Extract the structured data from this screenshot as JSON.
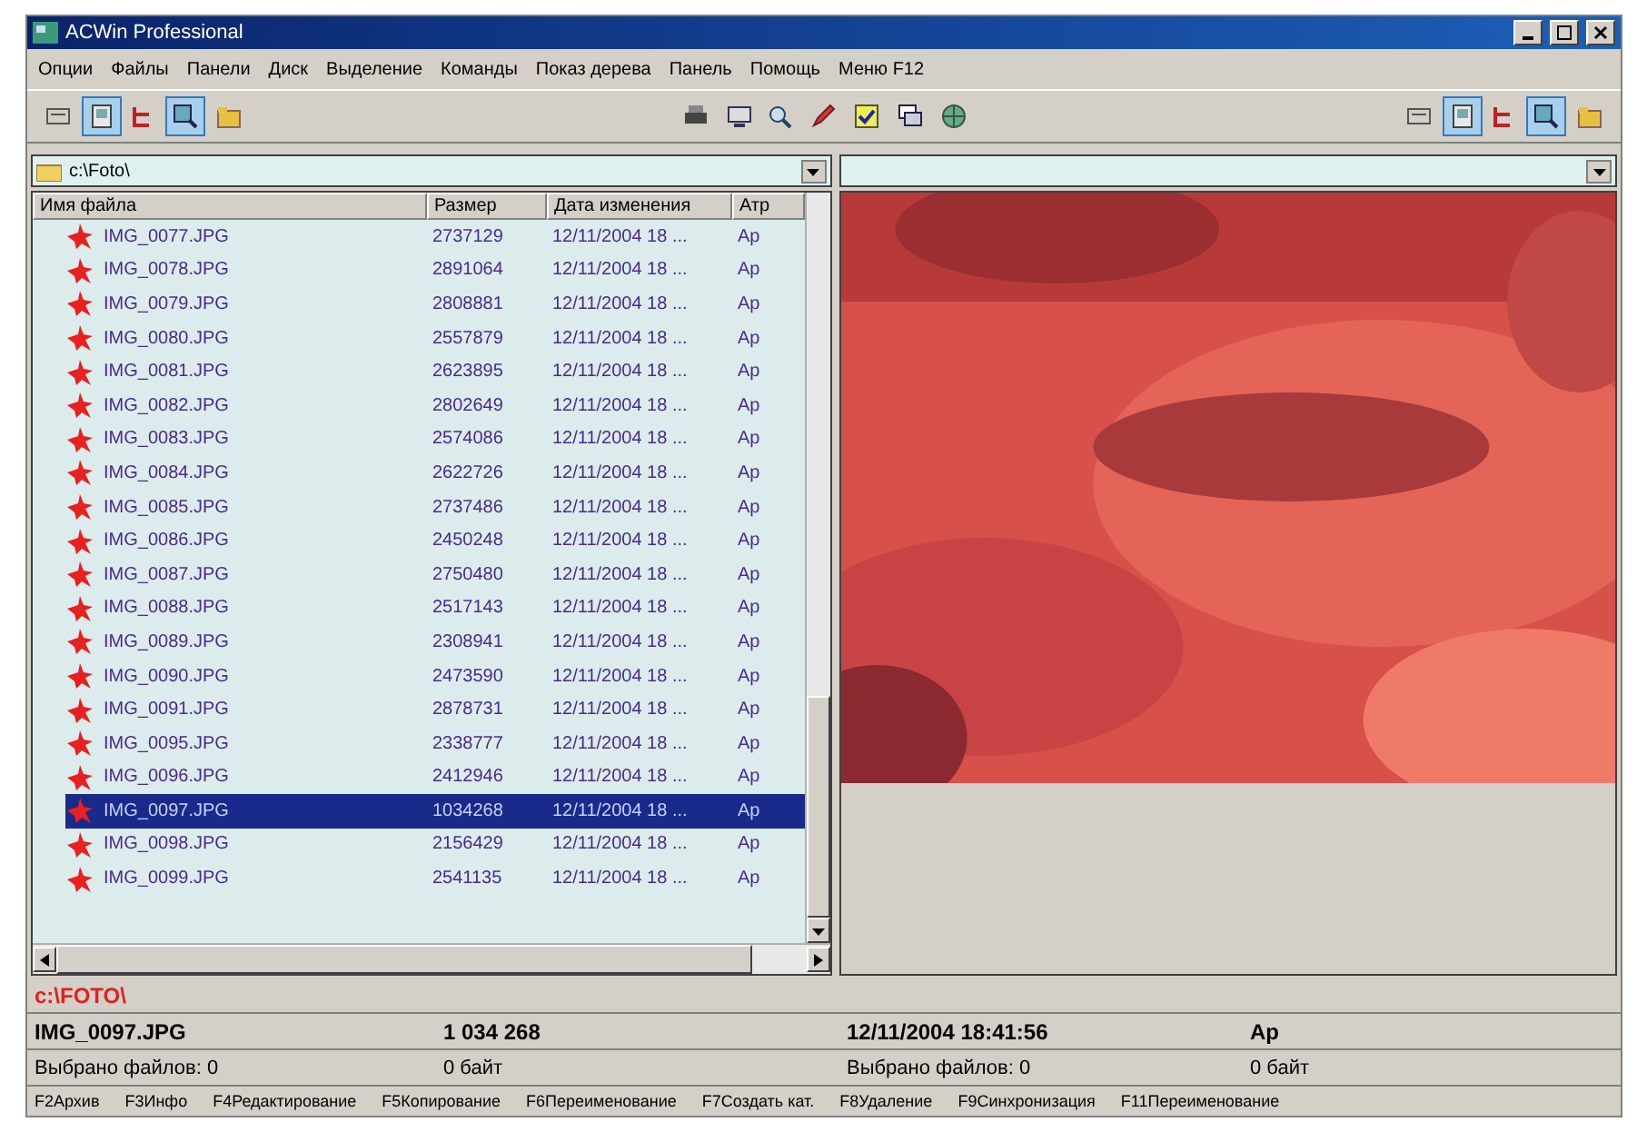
{
  "window": {
    "title": "ACWin Professional"
  },
  "menu": [
    "Опции",
    "Файлы",
    "Панели",
    "Диск",
    "Выделение",
    "Команды",
    "Показ дерева",
    "Панель",
    "Помощь",
    "Меню F12"
  ],
  "toolbar": [
    [
      {
        "kind": "list",
        "pressed": false
      },
      {
        "kind": "detail",
        "pressed": true
      }
    ],
    [
      {
        "kind": "tree",
        "pressed": false
      },
      {
        "kind": "view",
        "pressed": true
      },
      {
        "kind": "folder",
        "pressed": false
      }
    ],
    [
      {
        "kind": "print",
        "pressed": false
      },
      {
        "kind": "monitor",
        "pressed": false
      }
    ],
    [
      {
        "kind": "find",
        "pressed": false
      },
      {
        "kind": "edit",
        "pressed": false
      },
      {
        "kind": "check",
        "pressed": false
      },
      {
        "kind": "window",
        "pressed": false
      },
      {
        "kind": "globe",
        "pressed": false
      }
    ],
    [
      {
        "kind": "list",
        "pressed": false
      },
      {
        "kind": "detail",
        "pressed": true
      }
    ],
    [
      {
        "kind": "tree",
        "pressed": false
      },
      {
        "kind": "view",
        "pressed": true
      },
      {
        "kind": "folder",
        "pressed": false
      }
    ]
  ],
  "left_panel": {
    "path": "c:\\Foto\\",
    "columns": [
      "Имя файла",
      "Размер",
      "Дата изменения",
      "Атр"
    ],
    "rows": [
      {
        "name": "IMG_0077.JPG",
        "size": "2737129",
        "date": "12/11/2004 18 ...",
        "attr": "Ap",
        "selected": false
      },
      {
        "name": "IMG_0078.JPG",
        "size": "2891064",
        "date": "12/11/2004 18 ...",
        "attr": "Ap",
        "selected": false
      },
      {
        "name": "IMG_0079.JPG",
        "size": "2808881",
        "date": "12/11/2004 18 ...",
        "attr": "Ap",
        "selected": false
      },
      {
        "name": "IMG_0080.JPG",
        "size": "2557879",
        "date": "12/11/2004 18 ...",
        "attr": "Ap",
        "selected": false
      },
      {
        "name": "IMG_0081.JPG",
        "size": "2623895",
        "date": "12/11/2004 18 ...",
        "attr": "Ap",
        "selected": false
      },
      {
        "name": "IMG_0082.JPG",
        "size": "2802649",
        "date": "12/11/2004 18 ...",
        "attr": "Ap",
        "selected": false
      },
      {
        "name": "IMG_0083.JPG",
        "size": "2574086",
        "date": "12/11/2004 18 ...",
        "attr": "Ap",
        "selected": false
      },
      {
        "name": "IMG_0084.JPG",
        "size": "2622726",
        "date": "12/11/2004 18 ...",
        "attr": "Ap",
        "selected": false
      },
      {
        "name": "IMG_0085.JPG",
        "size": "2737486",
        "date": "12/11/2004 18 ...",
        "attr": "Ap",
        "selected": false
      },
      {
        "name": "IMG_0086.JPG",
        "size": "2450248",
        "date": "12/11/2004 18 ...",
        "attr": "Ap",
        "selected": false
      },
      {
        "name": "IMG_0087.JPG",
        "size": "2750480",
        "date": "12/11/2004 18 ...",
        "attr": "Ap",
        "selected": false
      },
      {
        "name": "IMG_0088.JPG",
        "size": "2517143",
        "date": "12/11/2004 18 ...",
        "attr": "Ap",
        "selected": false
      },
      {
        "name": "IMG_0089.JPG",
        "size": "2308941",
        "date": "12/11/2004 18 ...",
        "attr": "Ap",
        "selected": false
      },
      {
        "name": "IMG_0090.JPG",
        "size": "2473590",
        "date": "12/11/2004 18 ...",
        "attr": "Ap",
        "selected": false
      },
      {
        "name": "IMG_0091.JPG",
        "size": "2878731",
        "date": "12/11/2004 18 ...",
        "attr": "Ap",
        "selected": false
      },
      {
        "name": "IMG_0095.JPG",
        "size": "2338777",
        "date": "12/11/2004 18 ...",
        "attr": "Ap",
        "selected": false
      },
      {
        "name": "IMG_0096.JPG",
        "size": "2412946",
        "date": "12/11/2004 18 ...",
        "attr": "Ap",
        "selected": false
      },
      {
        "name": "IMG_0097.JPG",
        "size": "1034268",
        "date": "12/11/2004 18 ...",
        "attr": "Ap",
        "selected": true
      },
      {
        "name": "IMG_0098.JPG",
        "size": "2156429",
        "date": "12/11/2004 18 ...",
        "attr": "Ap",
        "selected": false
      },
      {
        "name": "IMG_0099.JPG",
        "size": "2541135",
        "date": "12/11/2004 18 ...",
        "attr": "Ap",
        "selected": false
      }
    ]
  },
  "right_panel": {
    "preview": {
      "kind": "picture"
    }
  },
  "current_path": "c:\\FOTO\\",
  "status_bar": [
    [
      "IMG_0097.JPG",
      "1 034 268",
      "12/11/2004 18:41:56",
      "Ap"
    ],
    [
      "Выбрано файлов: 0",
      "0 байт",
      "Выбрано файлов: 0",
      "0 байт"
    ]
  ],
  "function_keys": [
    "F2Архив",
    "F3Инфо",
    "F4Редактирование",
    "F5Копирование",
    "F6Переименование",
    "F7Создать кат.",
    "F8Удаление",
    "F9Синхронизация",
    "F11Переименование"
  ]
}
